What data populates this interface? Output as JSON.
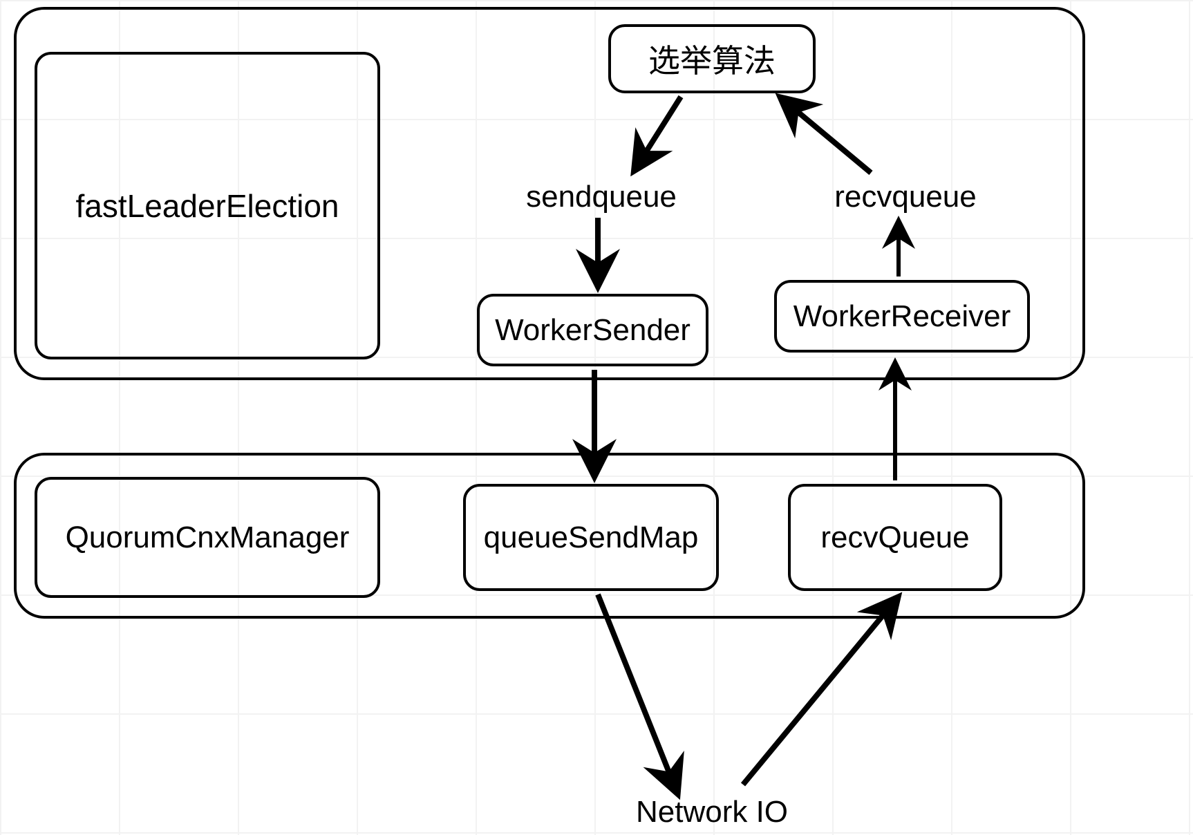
{
  "nodes": {
    "election_algorithm": "选举算法",
    "fast_leader_election": "fastLeaderElection",
    "sendqueue": "sendqueue",
    "recvqueue": "recvqueue",
    "worker_sender": "WorkerSender",
    "worker_receiver": "WorkerReceiver",
    "quorum_cnx_manager": "QuorumCnxManager",
    "queue_send_map": "queueSendMap",
    "recv_queue": "recvQueue",
    "network_io": "Network IO"
  },
  "edges": [
    {
      "from": "election_algorithm",
      "to": "sendqueue"
    },
    {
      "from": "sendqueue",
      "to": "worker_sender"
    },
    {
      "from": "worker_sender",
      "to": "queue_send_map"
    },
    {
      "from": "queue_send_map",
      "to": "network_io"
    },
    {
      "from": "network_io",
      "to": "recv_queue"
    },
    {
      "from": "recv_queue",
      "to": "worker_receiver"
    },
    {
      "from": "worker_receiver",
      "to": "recvqueue"
    },
    {
      "from": "recvqueue",
      "to": "election_algorithm"
    }
  ],
  "groups": {
    "top_group": [
      "election_algorithm",
      "fast_leader_election",
      "sendqueue",
      "recvqueue",
      "worker_sender",
      "worker_receiver"
    ],
    "bottom_group": [
      "quorum_cnx_manager",
      "queue_send_map",
      "recv_queue"
    ]
  }
}
